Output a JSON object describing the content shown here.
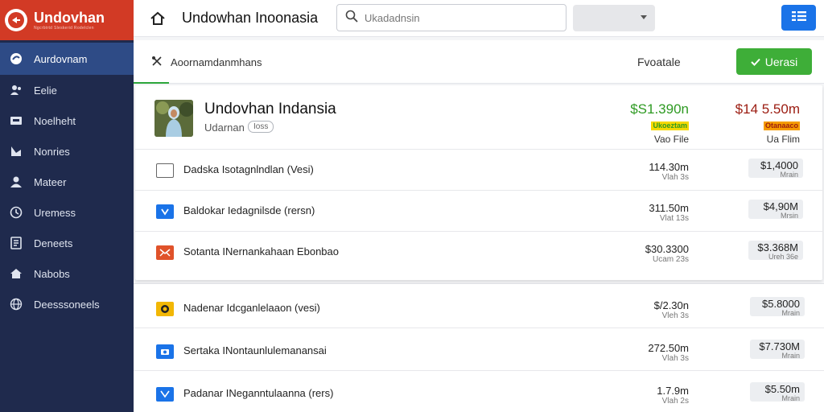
{
  "brand": {
    "name": "Undovhan",
    "tagline": "Ngcrbtrtd Sleskerid Rodelclen"
  },
  "sidebar": {
    "items": [
      {
        "label": "Aurdovnam",
        "icon": "chat-bubble-icon"
      },
      {
        "label": "Eelie",
        "icon": "people-icon"
      },
      {
        "label": "Noelheht",
        "icon": "inbox-icon"
      },
      {
        "label": "Nonries",
        "icon": "flag-icon"
      },
      {
        "label": "Mateer",
        "icon": "user-icon"
      },
      {
        "label": "Uremess",
        "icon": "clock-icon"
      },
      {
        "label": "Deneets",
        "icon": "document-icon"
      },
      {
        "label": "Nabobs",
        "icon": "home-icon"
      },
      {
        "label": "Deesssoneels",
        "icon": "globe-icon"
      }
    ]
  },
  "topbar": {
    "title": "Undowhan Inoonasia",
    "search_placeholder": "Ukadadnsin",
    "select_value": ""
  },
  "panel": {
    "tab_label": "Aoornamdanmhans",
    "filter_label": "Fvoatale",
    "primary_label": "Uerasi"
  },
  "feature": {
    "title": "Undovhan Indansia",
    "subtitle": "Udarnan",
    "badge": "Ioss",
    "kpi1": {
      "value": "$S1.390n",
      "tag": "Ukoeztam",
      "label": "Vao File"
    },
    "kpi2": {
      "value": "$14 5.50m",
      "tag": "Otanaaco",
      "label": "Ua Flim"
    }
  },
  "rows": [
    {
      "icon": "checkbox-icon",
      "label": "Dadska Isotagnlndlan (Vesi)",
      "num": "114.30m",
      "num_sub": "Vlah 3s",
      "chip": "$1,4000",
      "chip_sub": "Mrain"
    },
    {
      "icon": "bag-icon",
      "label": "Baldokar Iedagnilsde (rersn)",
      "num": "311.50m",
      "num_sub": "Vlat 13s",
      "chip": "$4,90M",
      "chip_sub": "Mrsin"
    },
    {
      "icon": "envelope-icon",
      "label": "Sotanta INernankahaan Ebonbao",
      "num": "$30.3300",
      "num_sub": "Ucam 23s",
      "chip": "$3.368M",
      "chip_sub": "Ureh 36e"
    },
    {
      "icon": "coin-icon",
      "label": "Nadenar Idcganlelaaon (vesi)",
      "num": "$/2.30n",
      "num_sub": "Vleh 3s",
      "chip": "$5.8000",
      "chip_sub": "Mrain"
    },
    {
      "icon": "camera-icon",
      "label": "Sertaka INontaunlulemanansai",
      "num": "272.50m",
      "num_sub": "Vlah 3s",
      "chip": "$7.730M",
      "chip_sub": "Mrain"
    },
    {
      "icon": "mail-icon",
      "label": "Padanar INeganntulaanna (rers)",
      "num": "1.7.9m",
      "num_sub": "Vlah 2s",
      "chip": "$5.50m",
      "chip_sub": "Mrain"
    }
  ],
  "colors": {
    "sidebar_bg": "#1f2a4d",
    "sidebar_active": "#2e4b86",
    "brand_red": "#d23a25",
    "accent_green": "#3eae38",
    "accent_blue": "#1a73e8",
    "kpi_green": "#2e9a22",
    "kpi_red": "#9b1b10",
    "tag_yellow": "#f5d800",
    "tag_orange": "#f59b00"
  }
}
